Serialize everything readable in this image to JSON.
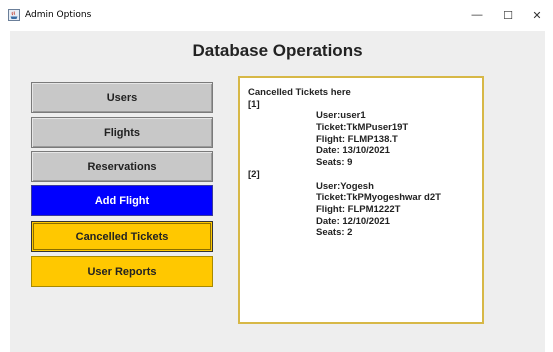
{
  "window": {
    "title": "Admin Options",
    "controls": {
      "minimize": "—",
      "maximize": "☐",
      "close": "✕"
    }
  },
  "heading": "Database Operations",
  "menu": [
    {
      "label": "Users",
      "color": "#c8c8c8"
    },
    {
      "label": "Flights",
      "color": "#c8c8c8"
    },
    {
      "label": "Reservations",
      "color": "#c8c8c8"
    },
    {
      "label": "Add Flight",
      "color": "#0000ff"
    },
    {
      "label": "Cancelled Tickets",
      "color": "#ffc800",
      "selected": true
    },
    {
      "label": "User Reports",
      "color": "#ffc800"
    }
  ],
  "panel": {
    "header": "Cancelled Tickets here",
    "tickets": [
      {
        "index": "[1]",
        "user": "User:user1",
        "ticket": "Ticket:TkMPuser19T",
        "flight": "Flight: FLMP138.T",
        "date": "Date: 13/10/2021",
        "seats": "Seats: 9"
      },
      {
        "index": "[2]",
        "user": "User:Yogesh",
        "ticket": "Ticket:TkPMyogeshwar d2T",
        "flight": "Flight: FLPM1222T",
        "date": "Date: 12/10/2021",
        "seats": "Seats: 2"
      }
    ]
  },
  "colors": {
    "panel_border": "#d7b847",
    "content_bg": "#eeeeee"
  }
}
